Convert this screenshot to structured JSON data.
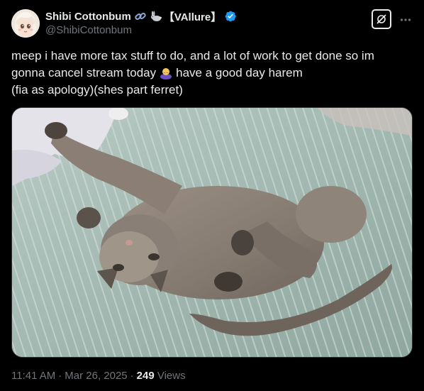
{
  "author": {
    "display_name": "Shibi Cottonbum",
    "name_emojis": [
      "link-emoji",
      "rabbit-emoji"
    ],
    "brand_tag": "【VAllure】",
    "handle": "@ShibiCottonbum",
    "verified": true,
    "verified_color": "#1d9bf0"
  },
  "tweet": {
    "line1": "meep i have more tax stuff to do, and a lot of work to get done so im",
    "line2_before": "gonna cancel stream today",
    "line2_emoji": "person-bowing-emoji",
    "line2_after": "have a good day harem",
    "line3": "(fia as apology)(shes part ferret)"
  },
  "media": {
    "icon": "photo-cat"
  },
  "meta": {
    "time": "11:41 AM",
    "date": "Mar 26, 2025",
    "views_count": "249",
    "views_label": "Views"
  },
  "actions": {
    "grok_icon": "grok-icon",
    "more_icon": "more-icon"
  },
  "colors": {
    "background": "#000000",
    "text_primary": "#e7e9ea",
    "text_secondary": "#71767b",
    "border": "#2f3336"
  }
}
